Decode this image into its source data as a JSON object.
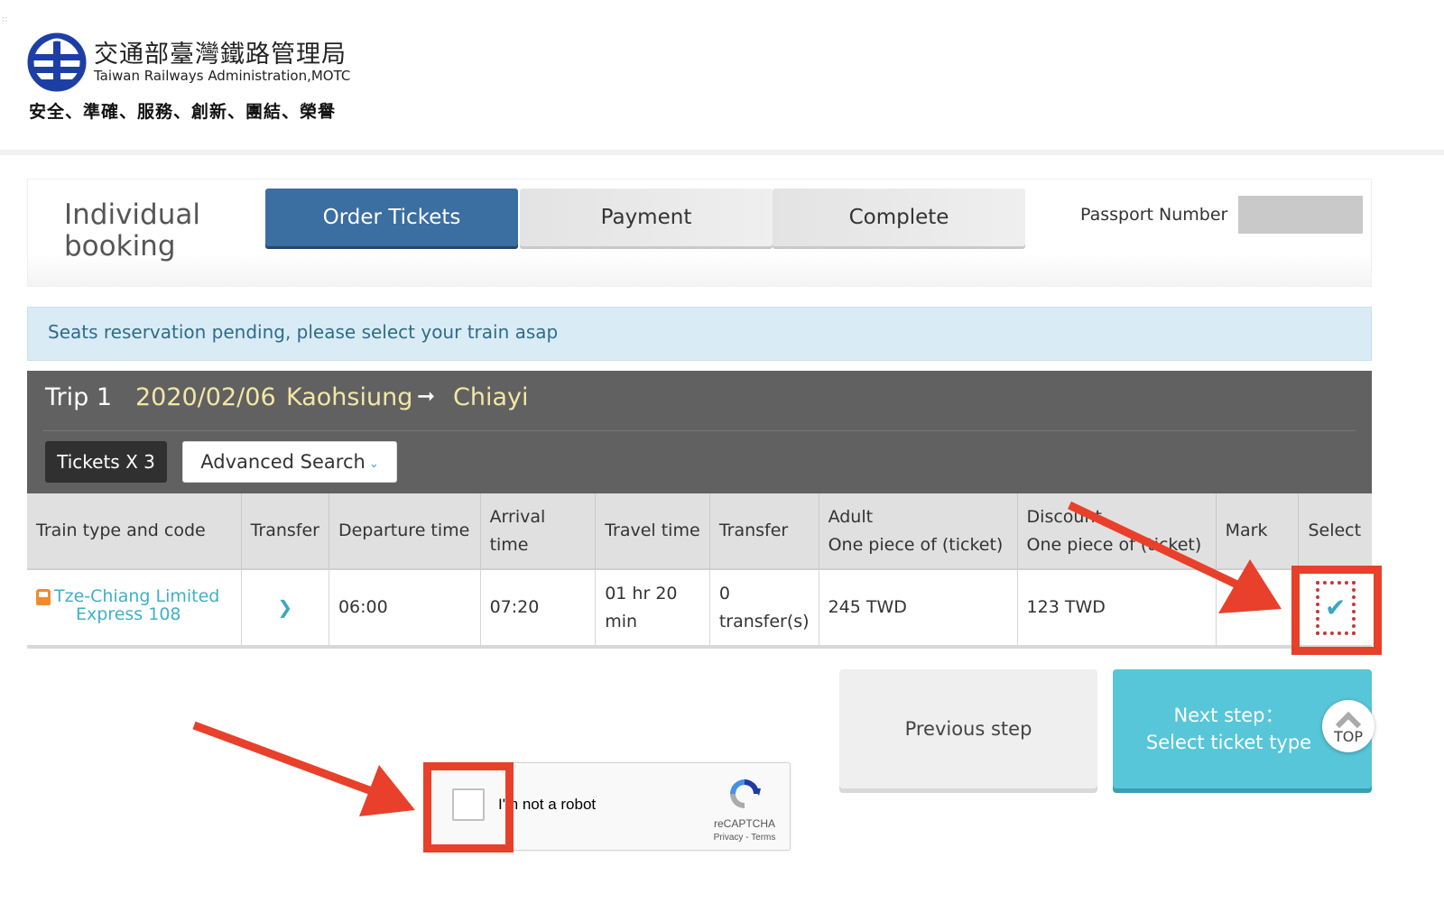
{
  "header": {
    "org_name_zh": "交通部臺灣鐵路管理局",
    "org_name_en": "Taiwan Railways Administration,MOTC",
    "slogan": "安全、準確、服務、創新、團結、榮譽",
    "logo_icon": "tra-logo-icon"
  },
  "booking": {
    "title": "Individual booking",
    "steps": [
      {
        "label": "Order Tickets",
        "active": true
      },
      {
        "label": "Payment",
        "active": false
      },
      {
        "label": "Complete",
        "active": false
      }
    ],
    "passport_label": "Passport Number",
    "passport_value": ""
  },
  "alert": {
    "message": "Seats reservation pending, please select your train asap"
  },
  "trip": {
    "title": "Trip 1",
    "date": "2020/02/06",
    "from": "Kaohsiung",
    "arrow": "➞",
    "to": "Chiayi",
    "tickets_label": "Tickets X 3",
    "advanced_search_label": "Advanced Search",
    "advanced_search_icon": "chevron-down-icon"
  },
  "table": {
    "headers": [
      "Train type and code",
      "Transfer",
      "Departure time",
      "Arrival time",
      "Travel time",
      "Transfer",
      "Adult\nOne piece of (ticket)",
      "Discount\nOne piece of (ticket)",
      "Mark",
      "Select"
    ],
    "header_adult_line1": "Adult",
    "header_adult_line2": "One piece of (ticket)",
    "header_discount_line1": "Discount",
    "header_discount_line2": "One piece of (ticket)",
    "rows": [
      {
        "train_line1": "Tze-Chiang Limited",
        "train_line2": "Express 108",
        "train_icon": "train-icon",
        "transfer_icon": "chevron-down-icon",
        "departure": "06:00",
        "arrival": "07:20",
        "travel_line1": "01 hr 20",
        "travel_line2": "min",
        "transfers_line1": "0",
        "transfers_line2": "transfer(s)",
        "adult_price": "245 TWD",
        "discount_price": "123 TWD",
        "mark": "",
        "selected": true,
        "select_icon": "✔"
      }
    ]
  },
  "actions": {
    "previous_label": "Previous step",
    "next_line1": "Next step：",
    "next_line2": "Select ticket type",
    "top_label": "TOP"
  },
  "recaptcha": {
    "label": "I'm not a robot",
    "brand": "reCAPTCHA",
    "links": "Privacy - Terms",
    "checked": false
  },
  "annotations": {
    "color": "#e8402a"
  }
}
